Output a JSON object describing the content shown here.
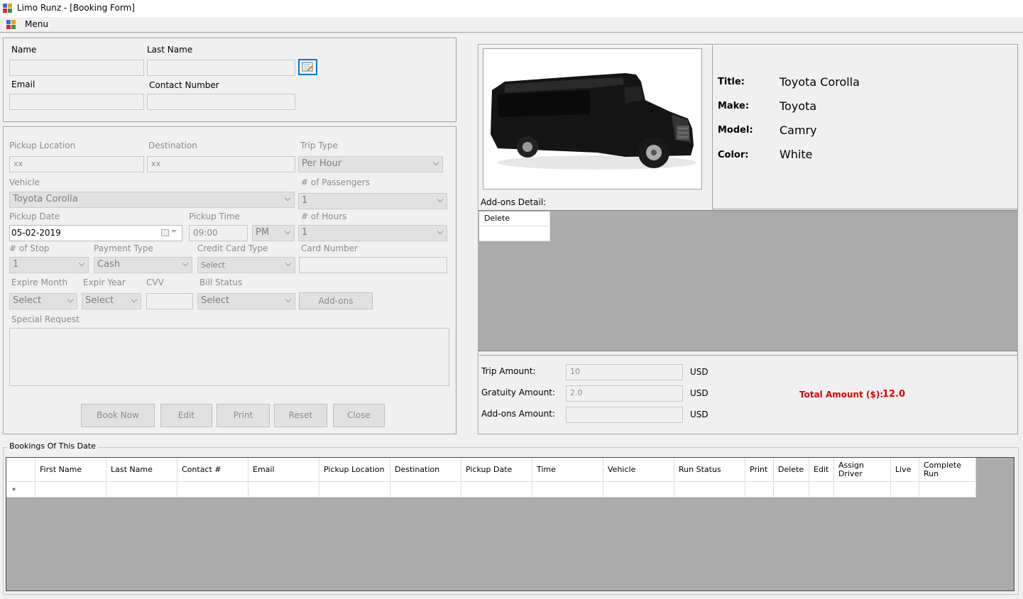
{
  "window": {
    "title": "Limo Runz - [Booking Form]"
  },
  "menu": {
    "label": "Menu"
  },
  "customer": {
    "name_label": "Name",
    "last_name_label": "Last Name",
    "email_label": "Email",
    "contact_label": "Contact Number",
    "name_value": "",
    "last_name_value": "",
    "email_value": "",
    "contact_value": ""
  },
  "trip": {
    "pickup_location_label": "Pickup Location",
    "pickup_location_value": "xx",
    "destination_label": "Destination",
    "destination_value": "xx",
    "trip_type_label": "Trip Type",
    "trip_type_value": "Per Hour",
    "vehicle_label": "Vehicle",
    "vehicle_value": "Toyota Corolla",
    "passengers_label": "# of Passengers",
    "passengers_value": "1",
    "pickup_date_label": "Pickup Date",
    "pickup_date_value": "05-02-2019",
    "pickup_time_label": "Pickup Time",
    "pickup_time_value": "09:00",
    "ampm_value": "PM",
    "hours_label": "# of Hours",
    "hours_value": "1",
    "stops_label": "# of Stop",
    "stops_value": "1",
    "payment_type_label": "Payment Type",
    "payment_type_value": "Cash",
    "cc_type_label": "Credit Card Type",
    "cc_type_value": "Select",
    "card_number_label": "Card Number",
    "card_number_value": "",
    "expire_month_label": "Expire Month",
    "expire_month_value": "Select",
    "expire_year_label": "Expir Year",
    "expire_year_value": "Select",
    "cvv_label": "CVV",
    "cvv_value": "",
    "bill_status_label": "Bill Status",
    "bill_status_value": "Select",
    "addons_button": "Add-ons",
    "special_request_label": "Special Request",
    "special_request_value": ""
  },
  "actions": {
    "book_now": "Book Now",
    "edit": "Edit",
    "print": "Print",
    "reset": "Reset",
    "close": "Close"
  },
  "vehicle_info": {
    "title_label": "Title:",
    "title_value": "Toyota Corolla",
    "make_label": "Make:",
    "make_value": "Toyota",
    "model_label": "Model:",
    "model_value": "Camry",
    "color_label": "Color:",
    "color_value": "White"
  },
  "addons": {
    "detail_label": "Add-ons Detail:",
    "column_delete": "Delete"
  },
  "amounts": {
    "trip_label": "Trip Amount:",
    "trip_value": "10",
    "gratuity_label": "Gratuity Amount:",
    "gratuity_value": "2.0",
    "addons_label": "Add-ons Amount:",
    "addons_value": "",
    "currency": "USD",
    "total_label": "Total Amount ($):",
    "total_value": "12.0"
  },
  "bookings": {
    "group_label": "Bookings Of This Date",
    "new_row_marker": "*",
    "columns": [
      "First Name",
      "Last Name",
      "Contact #",
      "Email",
      "Pickup Location",
      "Destination",
      "Pickup Date",
      "Time",
      "Vehicle",
      "Run Status",
      "Print",
      "Delete",
      "Edit",
      "Assign Driver",
      "Live",
      "Complete Run"
    ]
  },
  "colors": {
    "accent_total": "#e00000",
    "grid_bg": "#ababab"
  }
}
